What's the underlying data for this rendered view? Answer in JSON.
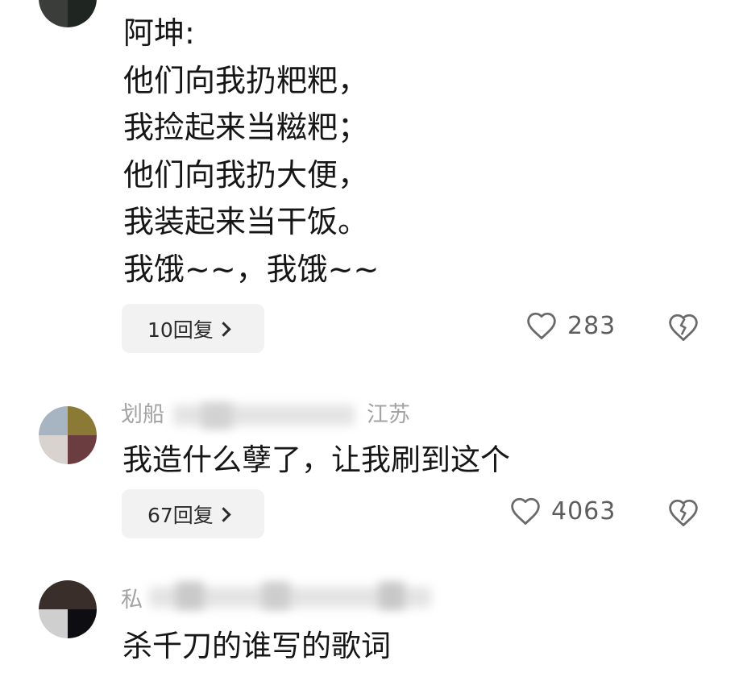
{
  "comments": [
    {
      "author": "阿坤:",
      "lines": [
        "他们向我扔粑粑，",
        "我捡起来当糍粑；",
        "他们向我扔大便，",
        "我装起来当干饭。",
        "我饿~~，我饿~~"
      ],
      "reply_label": "10回复",
      "likes": "283"
    },
    {
      "username_visible": "划船",
      "location_visible": "江苏",
      "text": "我造什么孽了，让我刷到这个",
      "reply_label": "67回复",
      "likes": "4063"
    },
    {
      "username_visible": "私",
      "text": "杀千刀的谁写的歌词"
    }
  ],
  "icons": {
    "like": "heart-outline-icon",
    "dislike": "broken-heart-icon",
    "chevron": "chevron-right-icon"
  },
  "colors": {
    "text": "#161616",
    "meta": "#a3a3a3",
    "reply_bg": "#f2f2f2",
    "icon": "#6a6a6a"
  }
}
